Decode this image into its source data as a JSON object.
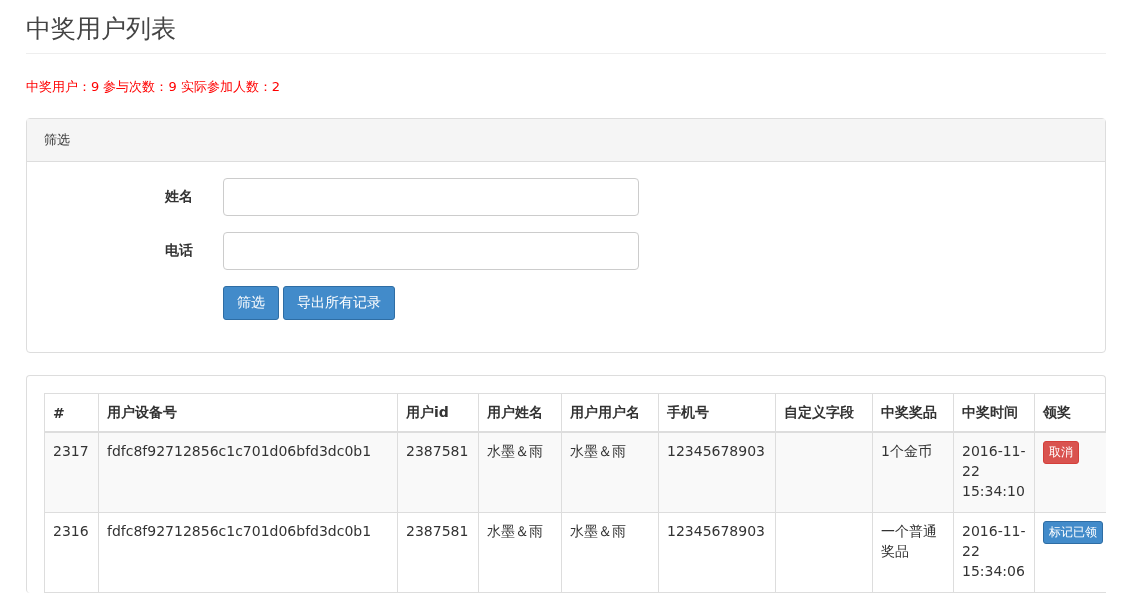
{
  "title": "中奖用户列表",
  "stats": "中奖用户：9 参与次数：9 实际参加人数：2",
  "filter": {
    "heading": "筛选",
    "fields": [
      {
        "label": "姓名"
      },
      {
        "label": "电话"
      }
    ],
    "buttons": [
      "筛选",
      "导出所有记录"
    ]
  },
  "table": {
    "columns": [
      "#",
      "用户设备号",
      "用户id",
      "用户姓名",
      "用户用户名",
      "手机号",
      "自定义字段",
      "中奖奖品",
      "中奖时间",
      "领奖"
    ],
    "rows": [
      {
        "cells": [
          "2317",
          "fdfc8f92712856c1c701d06bfd3dc0b1",
          "2387581",
          "水墨＆雨",
          "水墨＆雨",
          "12345678903",
          "",
          "1个金币",
          "2016-11-22 15:34:10"
        ],
        "action": {
          "label": "取消",
          "kind": "danger"
        }
      },
      {
        "cells": [
          "2316",
          "fdfc8f92712856c1c701d06bfd3dc0b1",
          "2387581",
          "水墨＆雨",
          "水墨＆雨",
          "12345678903",
          "",
          "一个普通奖品",
          "2016-11-22 15:34:06"
        ],
        "action": {
          "label": "标记已领",
          "kind": "primary"
        }
      }
    ]
  }
}
